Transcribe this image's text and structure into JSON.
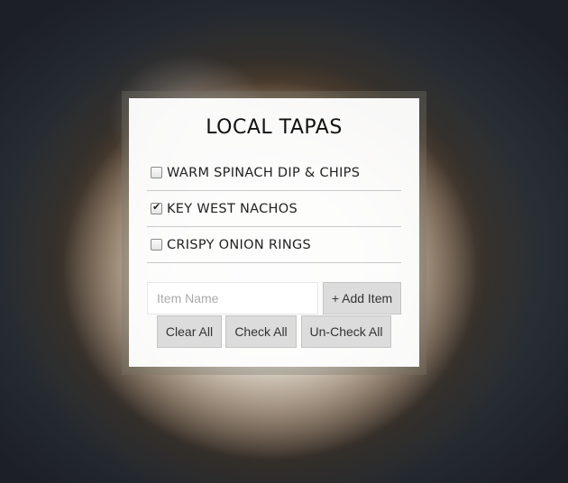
{
  "card": {
    "title": "LOCAL TAPAS"
  },
  "items": [
    {
      "label": "WARM SPINACH DIP & CHIPS",
      "checked": false
    },
    {
      "label": "KEY WEST NACHOS",
      "checked": true
    },
    {
      "label": "CRISPY ONION RINGS",
      "checked": false
    }
  ],
  "form": {
    "item_placeholder": "Item Name",
    "add_label": "+ Add Item"
  },
  "actions": {
    "clear_all": "Clear All",
    "check_all": "Check All",
    "uncheck_all": "Un-Check All"
  }
}
